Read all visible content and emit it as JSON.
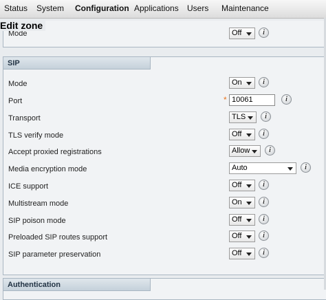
{
  "nav": {
    "items": [
      "Status",
      "System",
      "Configuration",
      "Applications",
      "Users",
      "Maintenance"
    ],
    "active": "Configuration"
  },
  "page": {
    "title": "Edit zone"
  },
  "top_partial": {
    "label": "Mode",
    "value": "Off"
  },
  "sip": {
    "header": "SIP",
    "rows": [
      {
        "label": "Mode",
        "value": "On"
      },
      {
        "label": "Port",
        "value": "10061",
        "required_mark": "*"
      },
      {
        "label": "Transport",
        "value": "TLS"
      },
      {
        "label": "TLS verify mode",
        "value": "Off"
      },
      {
        "label": "Accept proxied registrations",
        "value": "Allow"
      },
      {
        "label": "Media encryption mode",
        "value": "Auto"
      },
      {
        "label": "ICE support",
        "value": "Off"
      },
      {
        "label": "Multistream mode",
        "value": "On"
      },
      {
        "label": "SIP poison mode",
        "value": "Off"
      },
      {
        "label": "Preloaded SIP routes support",
        "value": "Off"
      },
      {
        "label": "SIP parameter preservation",
        "value": "Off"
      }
    ]
  },
  "authentication": {
    "header": "Authentication"
  },
  "info_glyph": "i",
  "colors": {
    "accent_star": "#e8731c",
    "section_header": "#c5d1db"
  }
}
